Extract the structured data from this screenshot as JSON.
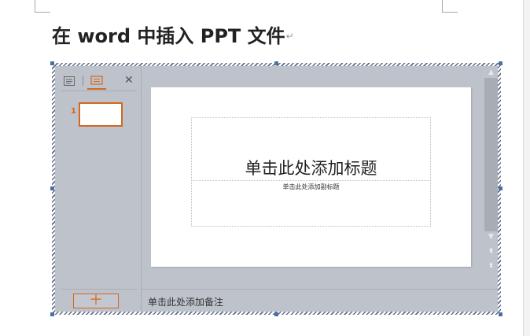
{
  "document": {
    "heading": "在 word 中插入 PPT 文件",
    "paragraph_mark": "↵"
  },
  "ppt_object": {
    "slide_pane": {
      "tabs": [
        {
          "icon": "outline-view-icon"
        },
        {
          "icon": "slides-view-icon",
          "active": true
        }
      ],
      "close_symbol": "✕",
      "slides": [
        {
          "number": "1"
        }
      ],
      "add_slide_symbol": "＋"
    },
    "slide": {
      "title_placeholder": "单击此处添加标题",
      "subtitle_placeholder": "单击此处添加副标题"
    },
    "notes_placeholder": "单击此处添加备注",
    "scrollbar": {
      "up": "▲",
      "down": "▼",
      "prev_slide": "⇞",
      "next_slide": "⇟"
    }
  },
  "colors": {
    "accent": "#d2691e",
    "object_background": "#bec2cb",
    "selection_hatch": "#5d6a86"
  }
}
